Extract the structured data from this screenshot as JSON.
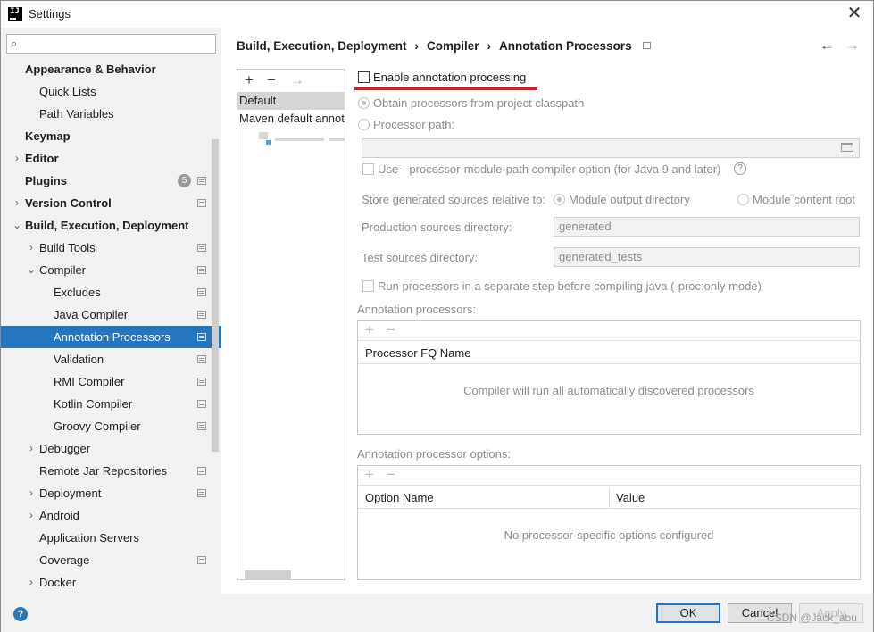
{
  "window": {
    "title": "Settings",
    "close_glyph": "✕"
  },
  "search": {
    "value": "",
    "placeholder": ""
  },
  "tree": [
    {
      "label": "Appearance & Behavior",
      "level": 0,
      "bold": true,
      "arrow": "",
      "page_icon": false
    },
    {
      "label": "Quick Lists",
      "level": 1,
      "bold": false,
      "arrow": "",
      "page_icon": false
    },
    {
      "label": "Path Variables",
      "level": 1,
      "bold": false,
      "arrow": "",
      "page_icon": false
    },
    {
      "label": "Keymap",
      "level": 0,
      "bold": true,
      "arrow": "",
      "page_icon": false
    },
    {
      "label": "Editor",
      "level": 0,
      "bold": true,
      "arrow": "›",
      "page_icon": false
    },
    {
      "label": "Plugins",
      "level": 0,
      "bold": true,
      "arrow": "",
      "page_icon": true,
      "badge": "5"
    },
    {
      "label": "Version Control",
      "level": 0,
      "bold": true,
      "arrow": "›",
      "page_icon": true
    },
    {
      "label": "Build, Execution, Deployment",
      "level": 0,
      "bold": true,
      "arrow": "⌄",
      "page_icon": false
    },
    {
      "label": "Build Tools",
      "level": 1,
      "bold": false,
      "arrow": "›",
      "page_icon": true
    },
    {
      "label": "Compiler",
      "level": 1,
      "bold": false,
      "arrow": "⌄",
      "page_icon": true
    },
    {
      "label": "Excludes",
      "level": 2,
      "bold": false,
      "arrow": "",
      "page_icon": true
    },
    {
      "label": "Java Compiler",
      "level": 2,
      "bold": false,
      "arrow": "",
      "page_icon": true
    },
    {
      "label": "Annotation Processors",
      "level": 2,
      "bold": false,
      "arrow": "",
      "page_icon": true,
      "selected": true
    },
    {
      "label": "Validation",
      "level": 2,
      "bold": false,
      "arrow": "",
      "page_icon": true
    },
    {
      "label": "RMI Compiler",
      "level": 2,
      "bold": false,
      "arrow": "",
      "page_icon": true
    },
    {
      "label": "Kotlin Compiler",
      "level": 2,
      "bold": false,
      "arrow": "",
      "page_icon": true
    },
    {
      "label": "Groovy Compiler",
      "level": 2,
      "bold": false,
      "arrow": "",
      "page_icon": true
    },
    {
      "label": "Debugger",
      "level": 1,
      "bold": false,
      "arrow": "›",
      "page_icon": false
    },
    {
      "label": "Remote Jar Repositories",
      "level": 1,
      "bold": false,
      "arrow": "",
      "page_icon": true
    },
    {
      "label": "Deployment",
      "level": 1,
      "bold": false,
      "arrow": "›",
      "page_icon": true
    },
    {
      "label": "Android",
      "level": 1,
      "bold": false,
      "arrow": "›",
      "page_icon": false
    },
    {
      "label": "Application Servers",
      "level": 1,
      "bold": false,
      "arrow": "",
      "page_icon": false
    },
    {
      "label": "Coverage",
      "level": 1,
      "bold": false,
      "arrow": "",
      "page_icon": true
    },
    {
      "label": "Docker",
      "level": 1,
      "bold": false,
      "arrow": "›",
      "page_icon": false
    }
  ],
  "breadcrumb": {
    "items": [
      "Build, Execution, Deployment",
      "Compiler",
      "Annotation Processors"
    ],
    "separator": "›"
  },
  "nav": {
    "back": "←",
    "forward": "→"
  },
  "profiles": {
    "toolbar": {
      "add": "+",
      "remove": "−",
      "move": "→"
    },
    "items": [
      "Default",
      "Maven default annot"
    ],
    "blurred_item": "pi-client-c"
  },
  "form": {
    "enable_annotation_processing": {
      "label": "Enable annotation processing",
      "checked": false
    },
    "obtain_from_classpath": {
      "label": "Obtain processors from project classpath",
      "selected": true
    },
    "processor_path": {
      "label": "Processor path:",
      "selected": false,
      "value": ""
    },
    "use_module_path": {
      "label": "Use --processor-module-path compiler option (for Java 9 and later)",
      "checked": false,
      "help": "?"
    },
    "store_generated": {
      "label": "Store generated sources relative to:",
      "option_module_output": "Module output directory",
      "option_module_content": "Module content root",
      "selected": "module_output"
    },
    "production_dir": {
      "label": "Production sources directory:",
      "value": "generated"
    },
    "test_dir": {
      "label": "Test sources directory:",
      "value": "generated_tests"
    },
    "run_separate_step": {
      "label": "Run processors in a separate step before compiling java (-proc:only mode)",
      "checked": false
    },
    "annotation_processors": {
      "title": "Annotation processors:",
      "column": "Processor FQ Name",
      "empty_text": "Compiler will run all automatically discovered processors"
    },
    "processor_options": {
      "title": "Annotation processor options:",
      "columns": [
        "Option Name",
        "Value"
      ],
      "empty_text": "No processor-specific options configured"
    }
  },
  "buttons": {
    "ok": "OK",
    "cancel": "Cancel",
    "apply": "Apply",
    "help": "?"
  },
  "watermark": "CSDN @Jack_abu",
  "colors": {
    "selection": "#2675bf",
    "annotation_underline": "#e0191f"
  }
}
